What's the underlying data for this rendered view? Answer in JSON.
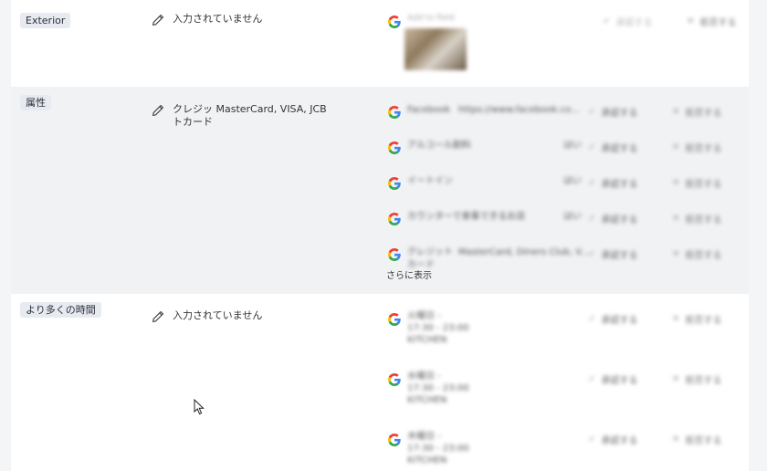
{
  "sections": {
    "exterior": {
      "label": "Exterior",
      "current_value": "入力されていません",
      "suggestion": {
        "text": "Add to field",
        "approve_label": "承認する",
        "reject_label": "拒否する"
      }
    },
    "attributes": {
      "label": "属性",
      "current_value": "クレジッ  MasterCard, VISA, JCB トカード",
      "suggestions": [
        {
          "text": "Facebook",
          "extra": "https://www.facebook.co...",
          "approve_label": "承認する",
          "reject_label": "拒否する"
        },
        {
          "text": "アルコール飲料",
          "extra": "はい",
          "approve_label": "承認する",
          "reject_label": "拒否する"
        },
        {
          "text": "イートイン",
          "extra": "はい",
          "approve_label": "承認する",
          "reject_label": "拒否する"
        },
        {
          "text": "カウンターで食事できるお店",
          "extra": "はい",
          "approve_label": "承認する",
          "reject_label": "拒否する"
        },
        {
          "text": "クレジット",
          "extra": "MasterCard, Diners Club, V...",
          "extra2": "カード",
          "approve_label": "承認する",
          "reject_label": "拒否する"
        }
      ],
      "more_label": "さらに表示"
    },
    "more_hours": {
      "label": "より多くの時間",
      "current_value": "入力されていません",
      "suggestions": [
        {
          "day": "火曜日 -",
          "time": "17:30 - 23:00",
          "name": "KITCHEN",
          "approve_label": "承認する",
          "reject_label": "拒否する"
        },
        {
          "day": "水曜日 -",
          "time": "17:30 - 23:00",
          "name": "KITCHEN",
          "approve_label": "承認する",
          "reject_label": "拒否する"
        },
        {
          "day": "木曜日 -",
          "time": "17:30 - 23:00",
          "name": "KITCHEN",
          "approve_label": "承認する",
          "reject_label": "拒否する"
        }
      ]
    }
  },
  "icons": {
    "approve": "check-icon",
    "reject": "x-icon",
    "edit": "pencil-icon",
    "source": "google-icon"
  },
  "colors": {
    "google_blue": "#4285F4",
    "google_red": "#EA4335",
    "google_yellow": "#FBBC05",
    "google_green": "#34A853",
    "pill_bg": "#e7eaf0"
  }
}
